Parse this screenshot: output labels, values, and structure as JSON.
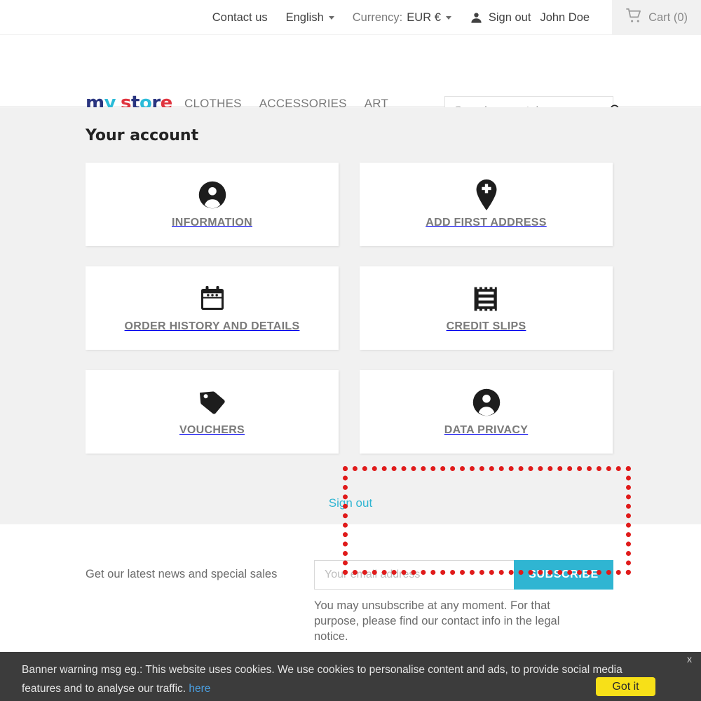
{
  "topbar": {
    "contact": "Contact us",
    "language": "English",
    "currency_label": "Currency:",
    "currency_value": "EUR €",
    "signout": "Sign out",
    "username": "John Doe",
    "cart": "Cart (0)"
  },
  "header": {
    "logo_parts": [
      {
        "text": "m",
        "color": "#2a3580"
      },
      {
        "text": "y",
        "color": "#2bbbd8"
      },
      {
        "text": " ",
        "color": "#2a3580"
      },
      {
        "text": "s",
        "color": "#e0343f"
      },
      {
        "text": "t",
        "color": "#2a3580"
      },
      {
        "text": "o",
        "color": "#2bbbd8"
      },
      {
        "text": "r",
        "color": "#2a3580"
      },
      {
        "text": "e",
        "color": "#e0343f"
      }
    ],
    "logo_text": "my store",
    "nav": [
      {
        "label": "CLOTHES"
      },
      {
        "label": "ACCESSORIES"
      },
      {
        "label": "ART"
      }
    ],
    "search_placeholder": "Search our catalog",
    "search_value": ""
  },
  "main": {
    "title": "Your account",
    "cards": [
      {
        "label": "INFORMATION",
        "icon": "person-circle-icon",
        "highlighted": false
      },
      {
        "label": "ADD FIRST ADDRESS",
        "icon": "map-pin-plus-icon",
        "highlighted": false
      },
      {
        "label": "ORDER HISTORY AND DETAILS",
        "icon": "calendar-icon",
        "highlighted": false
      },
      {
        "label": "CREDIT SLIPS",
        "icon": "receipt-icon",
        "highlighted": false
      },
      {
        "label": "VOUCHERS",
        "icon": "price-tag-icon",
        "highlighted": false
      },
      {
        "label": "DATA PRIVACY",
        "icon": "person-circle-icon",
        "highlighted": true
      }
    ],
    "signout_link": "Sign out",
    "highlight_color": "#e01b1b"
  },
  "newsletter": {
    "prompt": "Get our latest news and special sales",
    "email_placeholder": "Your email address",
    "email_value": "",
    "subscribe_label": "SUBSCRIBE",
    "note": "You may unsubscribe at any moment. For that purpose, please find our contact info in the legal notice.",
    "accent_color": "#2fb5d2"
  },
  "cookie_banner": {
    "text": "Banner warning msg eg.: This website uses cookies. We use cookies to personalise content and ads, to provide social media features and to analyse our traffic.",
    "link_text": "here",
    "button_label": "Got it",
    "close_label": "x",
    "background": "#3c3c3c",
    "button_color": "#f7e018"
  }
}
